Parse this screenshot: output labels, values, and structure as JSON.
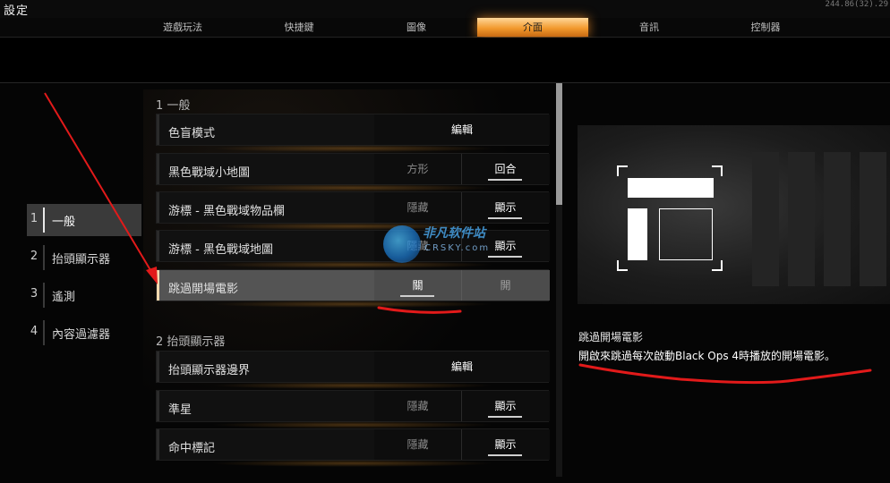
{
  "header": {
    "title": "設定",
    "version": "244.86(32).29"
  },
  "tabs": [
    {
      "label": "遊戲玩法",
      "active": false
    },
    {
      "label": "快捷鍵",
      "active": false
    },
    {
      "label": "圖像",
      "active": false
    },
    {
      "label": "介面",
      "active": true
    },
    {
      "label": "音訊",
      "active": false
    },
    {
      "label": "控制器",
      "active": false
    }
  ],
  "left_menu": [
    {
      "num": "1",
      "label": "一般",
      "active": true
    },
    {
      "num": "2",
      "label": "抬頭顯示器",
      "active": false
    },
    {
      "num": "3",
      "label": "遙測",
      "active": false
    },
    {
      "num": "4",
      "label": "內容過濾器",
      "active": false
    }
  ],
  "sections": {
    "general": {
      "header": "1 一般"
    },
    "hud": {
      "header": "2 抬頭顯示器"
    }
  },
  "rows": [
    {
      "label": "色盲模式",
      "edit": "編輯"
    },
    {
      "label": "黑色戰域小地圖",
      "opt1": "方形",
      "opt2": "回合",
      "selected_option": 2
    },
    {
      "label": "游標 - 黑色戰域物品欄",
      "opt1": "隱藏",
      "opt2": "顯示",
      "selected_option": 2
    },
    {
      "label": "游標 - 黑色戰域地圖",
      "opt1": "隱藏",
      "opt2": "顯示",
      "selected_option": 2
    },
    {
      "label": "跳過開場電影",
      "opt1": "關",
      "opt2": "開",
      "selected_option": 1,
      "highlighted": true
    },
    {
      "label": "抬頭顯示器邊界",
      "edit": "編輯"
    },
    {
      "label": "準星",
      "opt1": "隱藏",
      "opt2": "顯示",
      "selected_option": 2
    },
    {
      "label": "命中標記",
      "opt1": "隱藏",
      "opt2": "顯示",
      "selected_option": 2
    }
  ],
  "description": {
    "title": "跳過開場電影",
    "text": "開啟來跳過每次啟動Black Ops 4時播放的開場電影。"
  },
  "watermark": {
    "name": "非凡软件站",
    "site": "CRSKY.com"
  },
  "colors": {
    "accent": "#f29a2e",
    "annotation": "#e21a1a",
    "selected_row": "#545454"
  }
}
